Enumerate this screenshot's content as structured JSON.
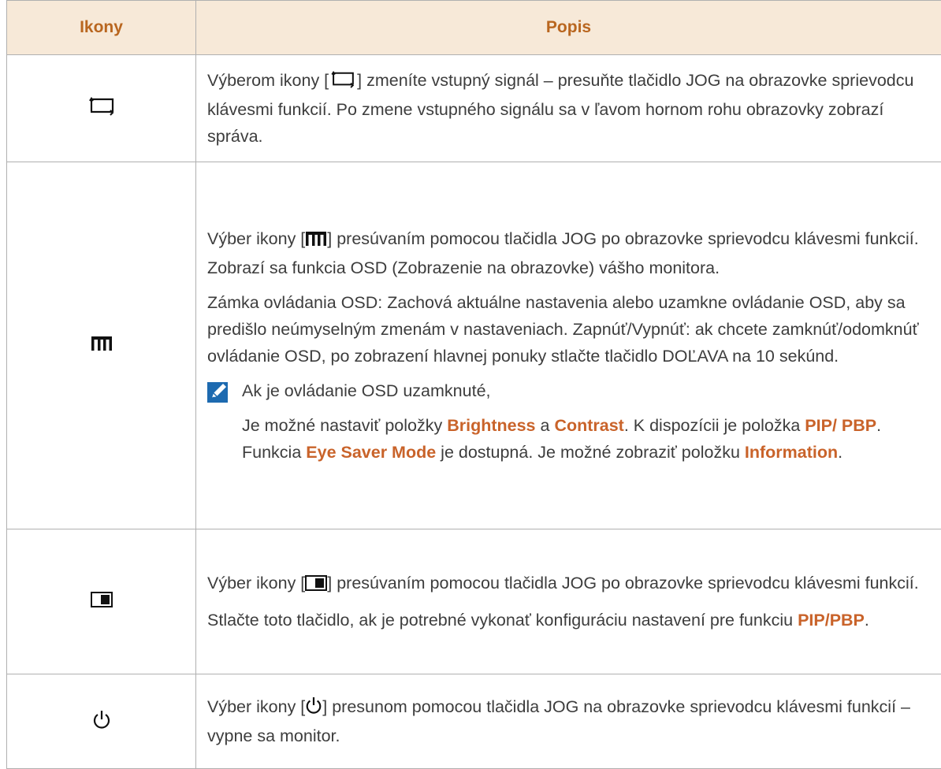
{
  "header": {
    "col_icons": "Ikony",
    "col_description": "Popis"
  },
  "rows": [
    {
      "icon": "source-icon",
      "paragraphs": [
        {
          "before": "Výberom ikony [",
          "after": "] zmeníte vstupný signál – presuňte tlačidlo JOG na obrazovke sprievodcu klávesmi funkcií. Po zmene vstupného signálu sa v ľavom hornom rohu obrazovky zobrazí správa."
        }
      ]
    },
    {
      "icon": "menu-icon",
      "paragraphs": [
        {
          "before": "Výber ikony [",
          "after": "] presúvaním pomocou tlačidla JOG po obrazovke sprievodcu klávesmi funkcií. Zobrazí sa funkcia OSD (Zobrazenie na obrazovke) vášho monitora."
        },
        {
          "text": "Zámka ovládania OSD: Zachová aktuálne nastavenia alebo uzamkne ovládanie OSD, aby sa predišlo neúmyselným zmenám v nastaveniach. Zapnúť/Vypnúť: ak chcete zamknúť/odomknúť ovládanie OSD, po zobrazení hlavnej ponuky stlačte tlačidlo DOĽAVA na 10 sekúnd."
        }
      ],
      "note": {
        "icon": "note-pencil-icon",
        "line1": "Ak je ovládanie OSD uzamknuté,",
        "line2": {
          "t1": "Je možné nastaviť položky ",
          "h1": "Brightness",
          "t2": " a ",
          "h2": "Contrast",
          "t3": ". K dispozícii je položka ",
          "h3": "PIP/ PBP",
          "t4": ". Funkcia ",
          "h4": "Eye Saver Mode",
          "t5": " je dostupná. Je možné zobraziť položku ",
          "h5": "Information",
          "t6": "."
        }
      }
    },
    {
      "icon": "pip-icon",
      "paragraphs": [
        {
          "before": "Výber ikony [",
          "after": "] presúvaním pomocou tlačidla JOG po obrazovke sprievodcu klávesmi funkcií."
        },
        {
          "t1": "Stlačte toto tlačidlo, ak je potrebné vykonať konfiguráciu nastavení pre funkciu ",
          "h1": "PIP/PBP",
          "t2": "."
        }
      ]
    },
    {
      "icon": "power-icon",
      "paragraphs": [
        {
          "before": "Výber ikony [",
          "after": "] presunom pomocou tlačidla JOG na obrazovke sprievodcu klávesmi funkcií – vypne sa monitor."
        }
      ]
    }
  ],
  "colors": {
    "header_bg": "#f7e9d8",
    "header_text": "#b9661f",
    "highlight": "#c9632a",
    "body_text": "#3d3d3d",
    "note_icon": "#1d6ab0"
  }
}
